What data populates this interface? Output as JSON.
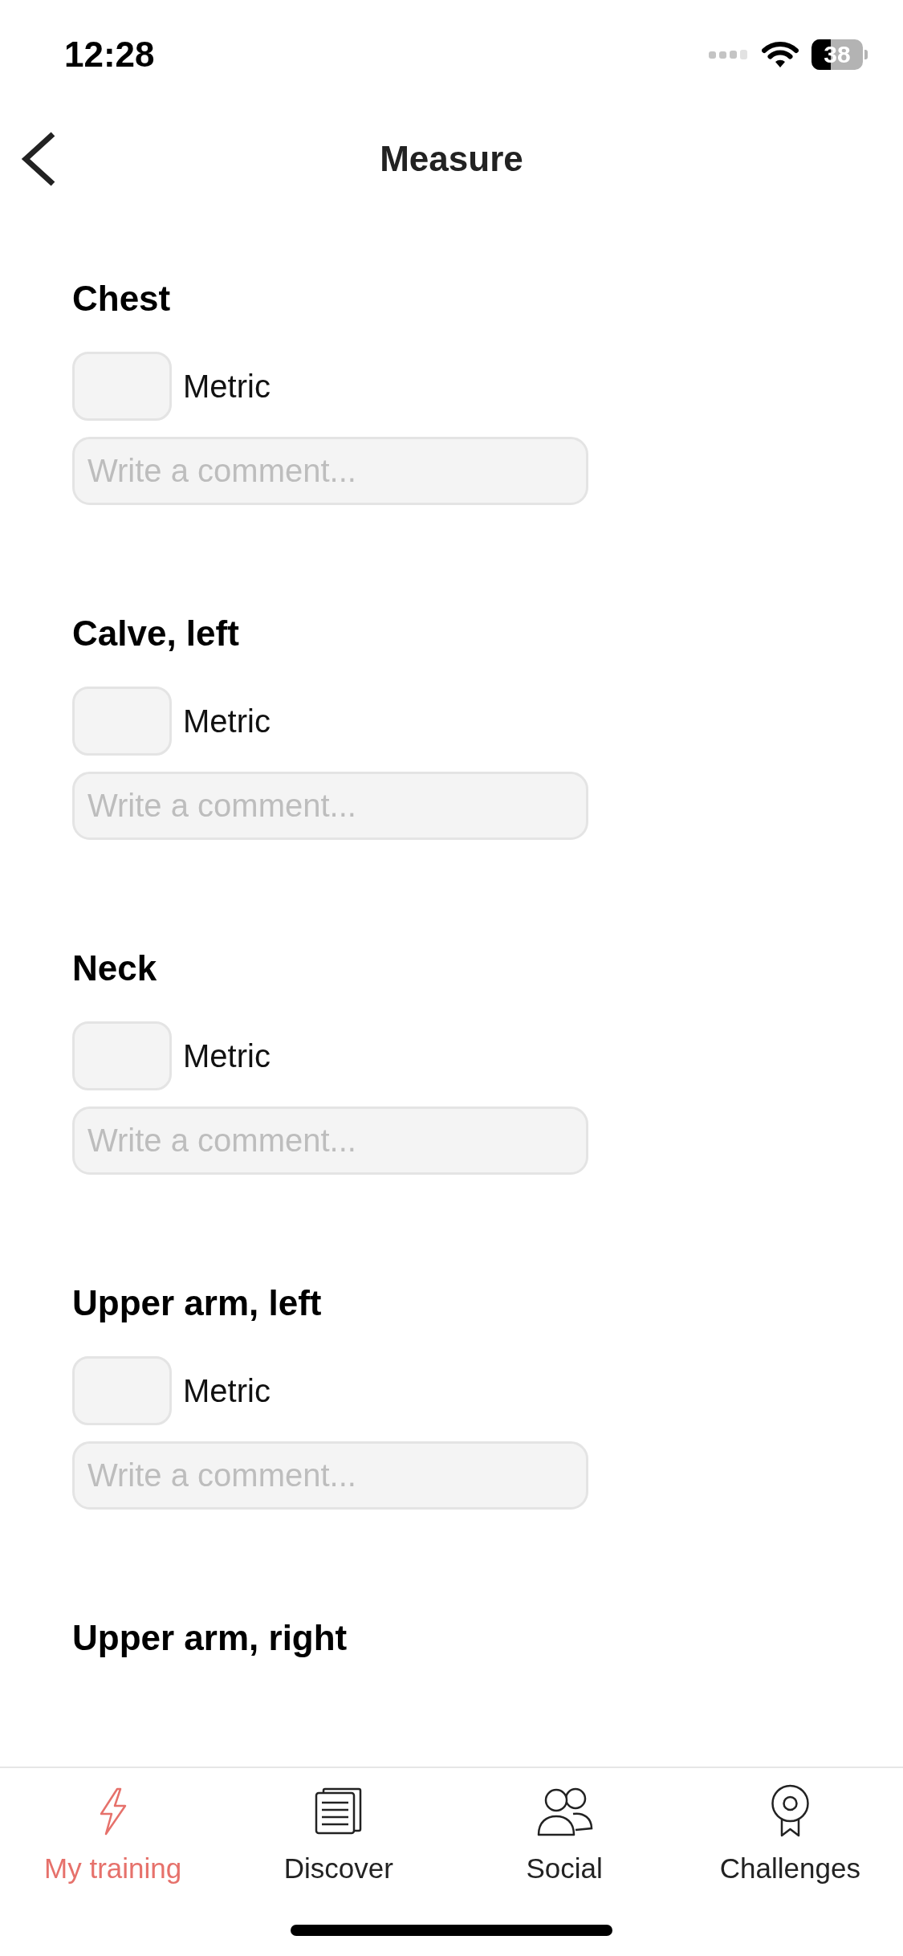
{
  "status_bar": {
    "time": "12:28",
    "battery": "38"
  },
  "header": {
    "title": "Measure"
  },
  "measurements": [
    {
      "name": "Chest",
      "unit": "Metric",
      "placeholder": "Write a comment..."
    },
    {
      "name": "Calve, left",
      "unit": "Metric",
      "placeholder": "Write a comment..."
    },
    {
      "name": "Neck",
      "unit": "Metric",
      "placeholder": "Write a comment..."
    },
    {
      "name": "Upper arm, left",
      "unit": "Metric",
      "placeholder": "Write a comment..."
    },
    {
      "name": "Upper arm, right"
    }
  ],
  "tab_bar": [
    {
      "label": "My training",
      "selected": true
    },
    {
      "label": "Discover",
      "selected": false
    },
    {
      "label": "Social",
      "selected": false
    },
    {
      "label": "Challenges",
      "selected": false
    }
  ]
}
